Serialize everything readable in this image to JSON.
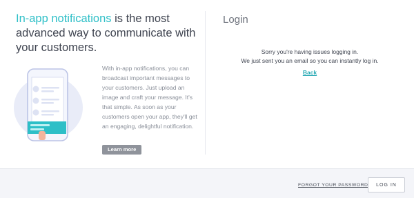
{
  "left_panel": {
    "headline_accent": "In-app notifications",
    "headline_rest": " is the most advanced way to communicate with your customers.",
    "description": "With in-app notifications, you can broadcast important messages to your customers. Just upload an image and craft your message. It's that simple. As soon as your customers open your app, they'll get an engaging, delightful notification.",
    "learn_more_label": "Learn more",
    "illustration_icon": "phone-notification-icon"
  },
  "right_panel": {
    "title": "Login",
    "message_line1": "Sorry you're having issues logging in.",
    "message_line2": "We just sent you an email so you can instantly log in.",
    "back_link": "Back"
  },
  "footer": {
    "forgot_label": "FORGOT YOUR PASSWORD?",
    "login_button": "LOG IN"
  },
  "colors": {
    "accent": "#2dbfc7",
    "text": "#3f4450",
    "muted": "#8a8f99",
    "footer_bg": "#f4f5f9"
  }
}
